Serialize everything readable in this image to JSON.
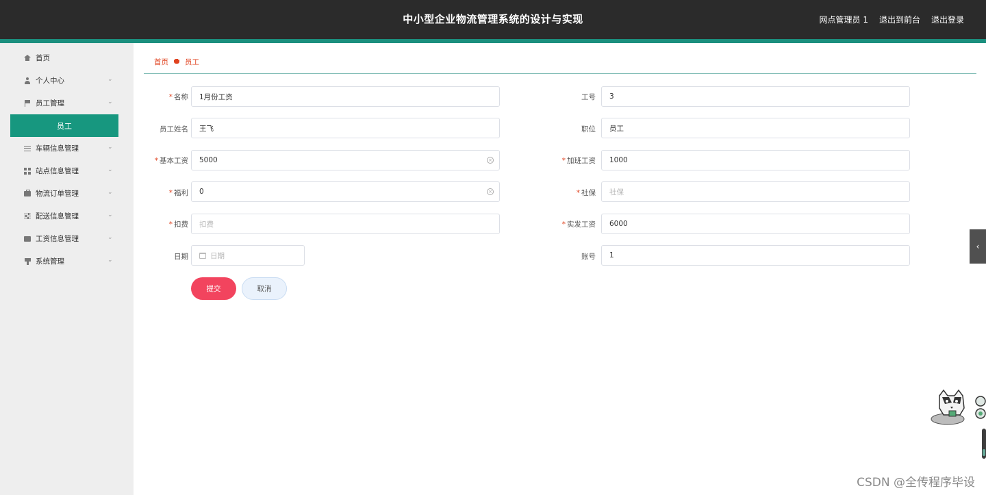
{
  "header": {
    "title": "中小型企业物流管理系统的设计与实现",
    "admin_label": "网点管理员 1",
    "back_to_front_label": "退出到前台",
    "logout_label": "退出登录"
  },
  "sidebar": {
    "items": [
      {
        "label": "首页",
        "icon": "home-icon",
        "expandable": false
      },
      {
        "label": "个人中心",
        "icon": "user-icon",
        "expandable": true
      },
      {
        "label": "员工管理",
        "icon": "flag-icon",
        "expandable": true
      },
      {
        "label": "车辆信息管理",
        "icon": "list-icon",
        "expandable": true
      },
      {
        "label": "站点信息管理",
        "icon": "grid-icon",
        "expandable": true
      },
      {
        "label": "物流订单管理",
        "icon": "box-icon",
        "expandable": true
      },
      {
        "label": "配送信息管理",
        "icon": "sliders-icon",
        "expandable": true
      },
      {
        "label": "工资信息管理",
        "icon": "card-icon",
        "expandable": true
      },
      {
        "label": "系统管理",
        "icon": "cup-icon",
        "expandable": true
      }
    ],
    "active_subitem": "员工"
  },
  "breadcrumb": {
    "home": "首页",
    "current": "员工"
  },
  "form": {
    "name": {
      "label": "名称",
      "required": true,
      "value": "1月份工资",
      "placeholder": "名称"
    },
    "employee_no": {
      "label": "工号",
      "required": false,
      "value": "3",
      "placeholder": "工号"
    },
    "employee_name": {
      "label": "员工姓名",
      "required": false,
      "value": "王飞",
      "placeholder": "员工姓名"
    },
    "position": {
      "label": "职位",
      "required": false,
      "value": "员工",
      "placeholder": "职位"
    },
    "base_salary": {
      "label": "基本工资",
      "required": true,
      "value": "5000",
      "placeholder": "基本工资"
    },
    "overtime_pay": {
      "label": "加班工资",
      "required": true,
      "value": "1000",
      "placeholder": "加班工资"
    },
    "welfare": {
      "label": "福利",
      "required": true,
      "value": "0",
      "placeholder": "福利"
    },
    "social_security": {
      "label": "社保",
      "required": true,
      "value": "",
      "placeholder": "社保"
    },
    "deduction": {
      "label": "扣费",
      "required": true,
      "value": "",
      "placeholder": "扣费"
    },
    "net_salary": {
      "label": "实发工资",
      "required": true,
      "value": "6000",
      "placeholder": "实发工资"
    },
    "date": {
      "label": "日期",
      "required": false,
      "value": "",
      "placeholder": "日期"
    },
    "account": {
      "label": "账号",
      "required": false,
      "value": "1",
      "placeholder": "账号"
    },
    "submit_label": "提交",
    "cancel_label": "取消"
  },
  "colors": {
    "header_bg": "#2b2b2b",
    "accent": "#17977f",
    "breadcrumb": "#e0421f",
    "submit": "#f2445e"
  },
  "watermark": "CSDN @全传程序毕设"
}
